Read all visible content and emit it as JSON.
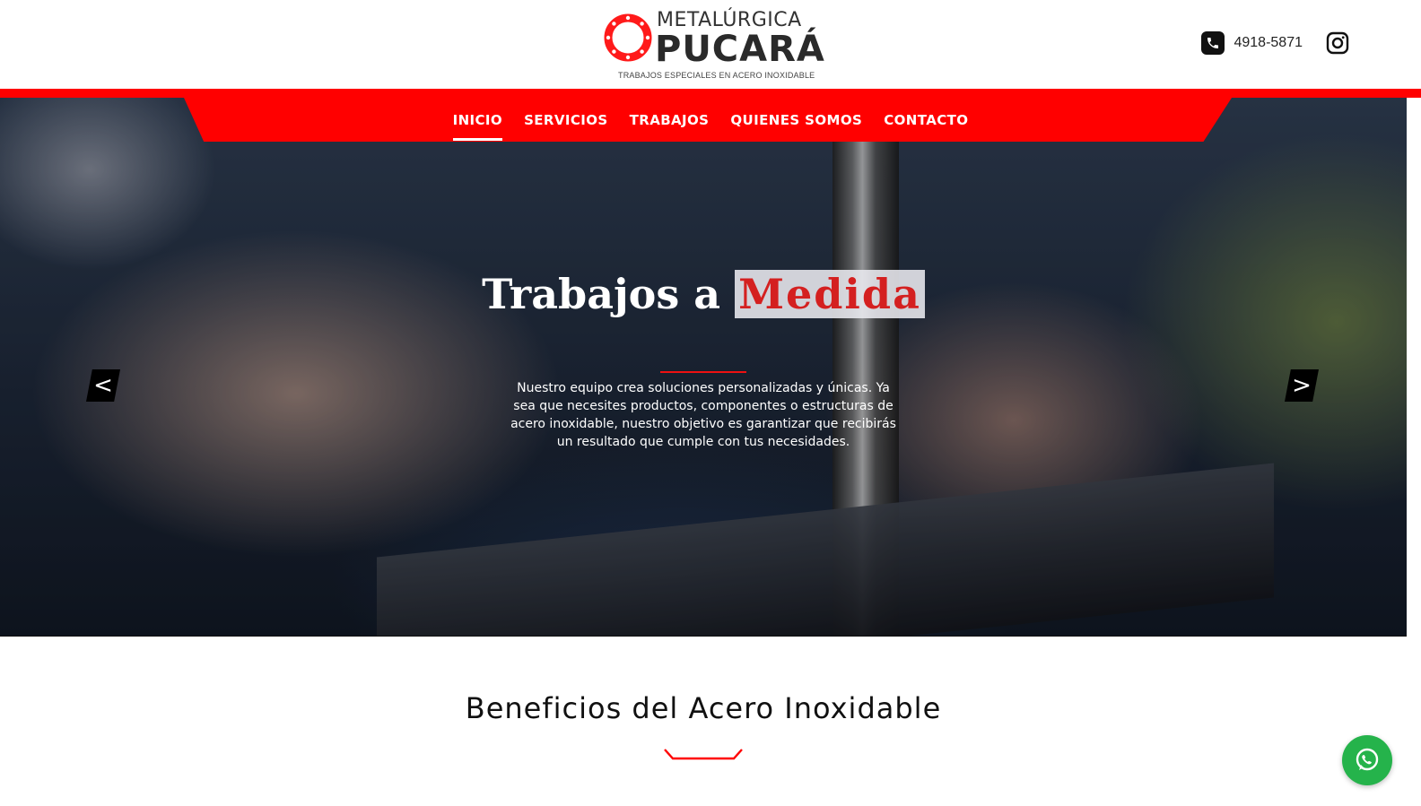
{
  "brand": {
    "top": "METALÚRGICA",
    "name": "PUCARÁ",
    "tagline": "TRABAJOS ESPECIALES EN ACERO INOXIDABLE"
  },
  "header": {
    "phone": "4918-5871",
    "phone_icon": "phone-icon",
    "social_icon": "instagram-icon"
  },
  "nav": {
    "items": [
      {
        "label": "INICIO",
        "active": true
      },
      {
        "label": "SERVICIOS"
      },
      {
        "label": "TRABAJOS"
      },
      {
        "label": "QUIENES SOMOS"
      },
      {
        "label": "CONTACTO"
      }
    ]
  },
  "hero": {
    "title_prefix": "Trabajos a",
    "title_highlight": "Medida",
    "text": "Nuestro equipo crea soluciones personalizadas y únicas. Ya sea que necesites productos, componentes o estructuras de acero inoxidable, nuestro objetivo es garantizar que recibirás un resultado que cumple con tus necesidades.",
    "prev": "<",
    "next": ">"
  },
  "section": {
    "title": "Beneficios del Acero Inoxidable"
  },
  "floating": {
    "whatsapp_icon": "whatsapp-icon"
  },
  "colors": {
    "accent": "#ff0000",
    "whatsapp": "#25b34b"
  }
}
